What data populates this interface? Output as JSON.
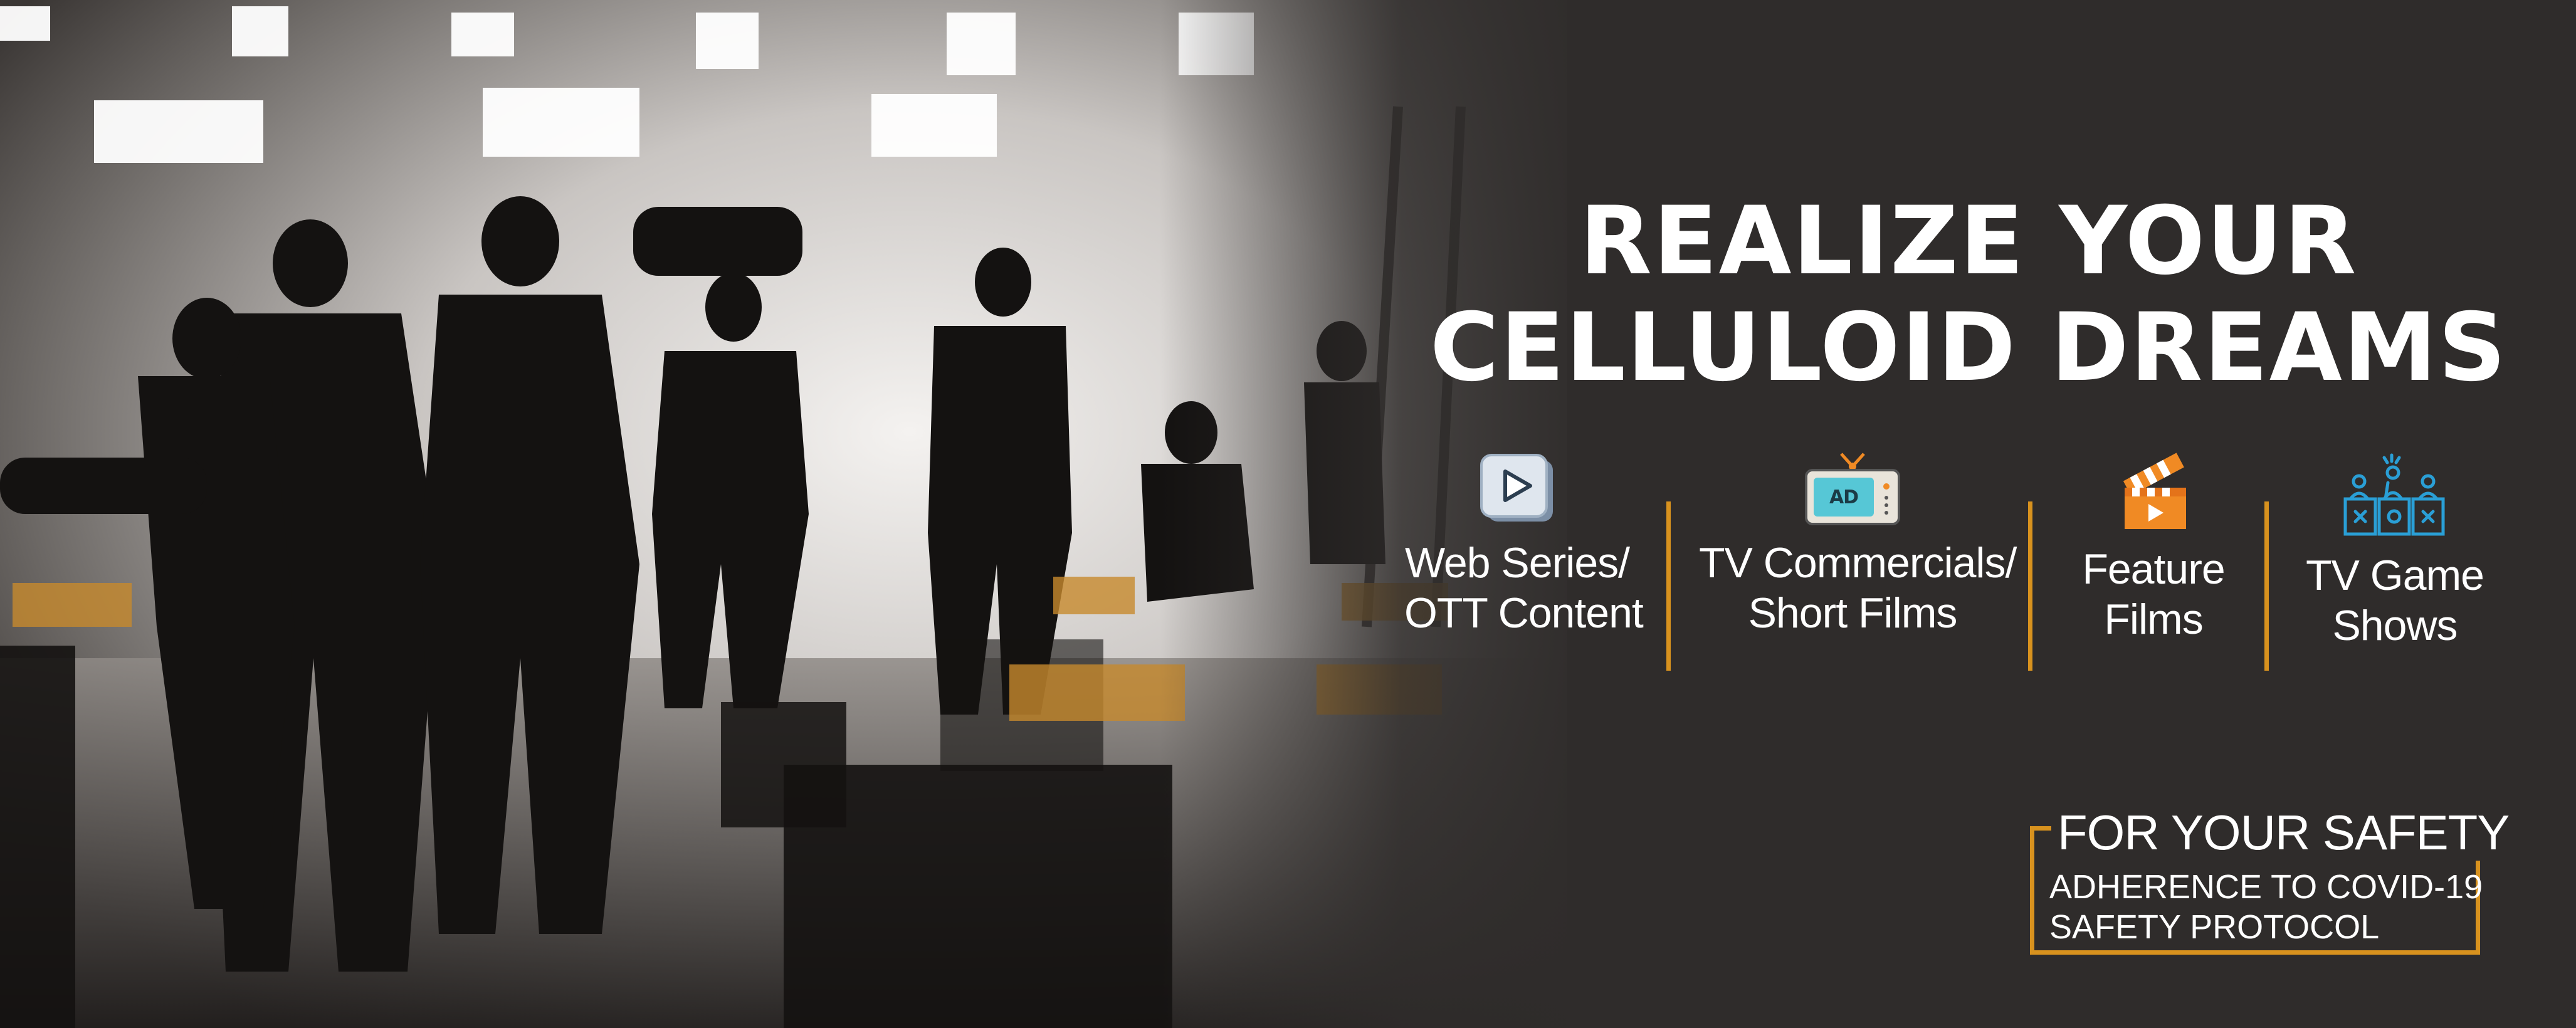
{
  "headline": {
    "line1": "REALIZE YOUR",
    "line2": "CELLULOID DREAMS"
  },
  "services": [
    {
      "icon": "play-video-icon",
      "line1": "Web Series/",
      "line2": "OTT Content"
    },
    {
      "icon": "tv-ad-icon",
      "line1": "TV Commercials/",
      "line2": "Short Films"
    },
    {
      "icon": "clapperboard-icon",
      "line1": "Feature",
      "line2": "Films"
    },
    {
      "icon": "game-show-contestants-icon",
      "line1": "TV Game",
      "line2": "Shows"
    }
  ],
  "safety": {
    "title": "FOR YOUR SAFETY",
    "line1": "ADHERENCE TO COVID-19",
    "line2": "SAFETY PROTOCOL"
  },
  "colors": {
    "background": "#2f2c2b",
    "accent": "#d8921e",
    "text": "#ffffff",
    "icon_blue": "#2a9fd6",
    "icon_orange": "#f08a24"
  }
}
